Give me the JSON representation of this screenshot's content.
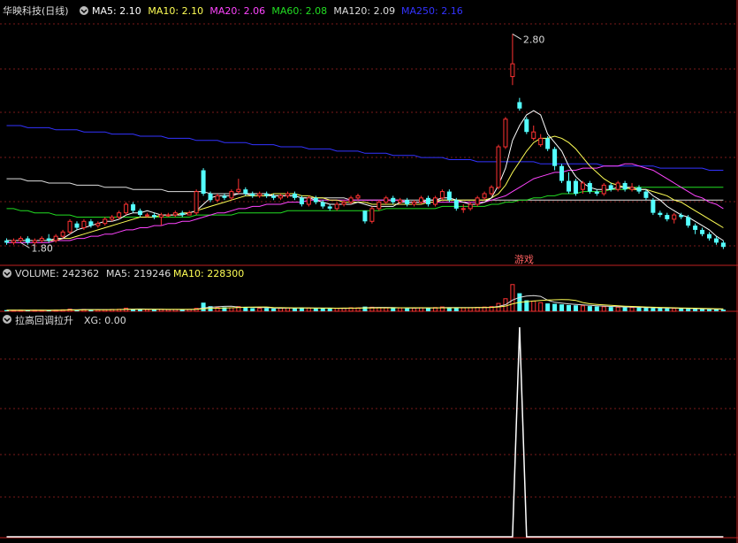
{
  "header": {
    "stock_name": "华映科技(日线)",
    "ma": [
      {
        "label": "MA5: 2.10",
        "color": "#ffffff"
      },
      {
        "label": "MA10: 2.10",
        "color": "#ffff55"
      },
      {
        "label": "MA20: 2.06",
        "color": "#ff44ff"
      },
      {
        "label": "MA60: 2.08",
        "color": "#22dd22"
      },
      {
        "label": "MA120: 2.09",
        "color": "#dddddd"
      },
      {
        "label": "MA250: 2.16",
        "color": "#3333ff"
      }
    ]
  },
  "price_panel": {
    "high_label": "2.80",
    "low_label": "1.80",
    "marker_label": "游戏"
  },
  "volume_panel": {
    "title": "VOLUME: 242362",
    "ma5": "MA5: 219246",
    "ma10": "MA10: 228300",
    "colors": {
      "title": "#dddddd",
      "ma5": "#dddddd",
      "ma10": "#ffff55"
    }
  },
  "indicator_panel": {
    "title": "拉高回调拉升",
    "value": "XG: 0.00"
  },
  "colors": {
    "up": "#ff3232",
    "down": "#54ffff",
    "grid": "#7a1a1a",
    "separator": "#c02020"
  },
  "chart_data": {
    "type": "candlestick",
    "ylim": [
      1.78,
      2.86
    ],
    "note_high": 2.8,
    "note_low": 1.8,
    "candles": [
      [
        1.83,
        1.82,
        1.84,
        1.81
      ],
      [
        1.82,
        1.83,
        1.84,
        1.81
      ],
      [
        1.83,
        1.84,
        1.85,
        1.82
      ],
      [
        1.84,
        1.82,
        1.85,
        1.81
      ],
      [
        1.82,
        1.83,
        1.84,
        1.81
      ],
      [
        1.83,
        1.84,
        1.85,
        1.82
      ],
      [
        1.84,
        1.83,
        1.86,
        1.82
      ],
      [
        1.83,
        1.85,
        1.86,
        1.82
      ],
      [
        1.85,
        1.87,
        1.88,
        1.84
      ],
      [
        1.87,
        1.92,
        1.93,
        1.86
      ],
      [
        1.91,
        1.89,
        1.92,
        1.88
      ],
      [
        1.89,
        1.92,
        1.93,
        1.88
      ],
      [
        1.92,
        1.9,
        1.93,
        1.89
      ],
      [
        1.9,
        1.91,
        1.92,
        1.89
      ],
      [
        1.91,
        1.93,
        1.94,
        1.9
      ],
      [
        1.93,
        1.94,
        1.95,
        1.92
      ],
      [
        1.94,
        1.96,
        1.97,
        1.93
      ],
      [
        1.96,
        2.0,
        2.01,
        1.95
      ],
      [
        2.0,
        1.97,
        2.01,
        1.96
      ],
      [
        1.97,
        1.95,
        1.98,
        1.94
      ],
      [
        1.95,
        1.95,
        1.96,
        1.94
      ],
      [
        1.95,
        1.94,
        1.96,
        1.93
      ],
      [
        1.94,
        1.95,
        1.96,
        1.9
      ],
      [
        1.95,
        1.95,
        1.96,
        1.94
      ],
      [
        1.95,
        1.96,
        1.97,
        1.94
      ],
      [
        1.96,
        1.95,
        1.97,
        1.94
      ],
      [
        1.95,
        1.96,
        1.97,
        1.95
      ],
      [
        1.96,
        2.06,
        2.07,
        1.95
      ],
      [
        2.16,
        2.05,
        2.17,
        2.04
      ],
      [
        2.05,
        2.02,
        2.06,
        2.01
      ],
      [
        2.02,
        2.04,
        2.05,
        2.01
      ],
      [
        2.04,
        2.03,
        2.05,
        2.02
      ],
      [
        2.03,
        2.06,
        2.07,
        2.02
      ],
      [
        2.06,
        2.07,
        2.12,
        2.05
      ],
      [
        2.07,
        2.05,
        2.08,
        2.04
      ],
      [
        2.05,
        2.04,
        2.06,
        2.03
      ],
      [
        2.04,
        2.05,
        2.06,
        2.03
      ],
      [
        2.05,
        2.04,
        2.06,
        2.03
      ],
      [
        2.04,
        2.03,
        2.05,
        2.02
      ],
      [
        2.03,
        2.04,
        2.05,
        2.02
      ],
      [
        2.04,
        2.05,
        2.06,
        2.03
      ],
      [
        2.05,
        2.03,
        2.06,
        2.02
      ],
      [
        2.03,
        2.0,
        2.04,
        1.99
      ],
      [
        2.0,
        2.03,
        2.04,
        1.99
      ],
      [
        2.03,
        2.01,
        2.04,
        2.0
      ],
      [
        2.01,
        1.99,
        2.02,
        1.98
      ],
      [
        1.99,
        1.98,
        2.0,
        1.97
      ],
      [
        1.98,
        2.0,
        2.01,
        1.97
      ],
      [
        2.0,
        2.01,
        2.02,
        1.99
      ],
      [
        2.01,
        2.03,
        2.04,
        2.0
      ],
      [
        2.03,
        2.04,
        2.05,
        2.02
      ],
      [
        1.97,
        1.92,
        1.97,
        1.91
      ],
      [
        1.92,
        1.98,
        1.99,
        1.91
      ],
      [
        1.98,
        2.01,
        2.02,
        1.97
      ],
      [
        2.01,
        2.03,
        2.04,
        2.0
      ],
      [
        2.03,
        2.01,
        2.04,
        2.0
      ],
      [
        2.01,
        2.02,
        2.03,
        2.0
      ],
      [
        2.02,
        2.0,
        2.03,
        1.99
      ],
      [
        2.0,
        2.01,
        2.02,
        1.99
      ],
      [
        2.01,
        2.03,
        2.04,
        2.0
      ],
      [
        2.03,
        2.0,
        2.04,
        1.99
      ],
      [
        2.0,
        2.03,
        2.04,
        1.99
      ],
      [
        2.03,
        2.06,
        2.07,
        2.02
      ],
      [
        2.06,
        2.02,
        2.07,
        2.01
      ],
      [
        2.02,
        1.98,
        2.03,
        1.97
      ],
      [
        1.98,
        1.98,
        2.0,
        1.96
      ],
      [
        1.98,
        2.0,
        2.01,
        1.97
      ],
      [
        2.0,
        2.03,
        2.04,
        1.99
      ],
      [
        2.03,
        2.05,
        2.06,
        2.02
      ],
      [
        2.05,
        2.08,
        2.09,
        2.04
      ],
      [
        2.08,
        2.27,
        2.28,
        2.07
      ],
      [
        2.27,
        2.4,
        2.41,
        2.26
      ],
      [
        2.6,
        2.66,
        2.8,
        2.56
      ],
      [
        2.48,
        2.45,
        2.5,
        2.44
      ],
      [
        2.4,
        2.34,
        2.41,
        2.33
      ],
      [
        2.31,
        2.34,
        2.37,
        2.3
      ],
      [
        2.28,
        2.31,
        2.33,
        2.27
      ],
      [
        2.31,
        2.26,
        2.32,
        2.25
      ],
      [
        2.26,
        2.18,
        2.27,
        2.16
      ],
      [
        2.18,
        2.11,
        2.19,
        2.1
      ],
      [
        2.11,
        2.06,
        2.15,
        2.05
      ],
      [
        2.11,
        2.05,
        2.12,
        2.04
      ],
      [
        2.07,
        2.1,
        2.11,
        2.05
      ],
      [
        2.1,
        2.06,
        2.11,
        2.05
      ],
      [
        2.06,
        2.05,
        2.07,
        2.04
      ],
      [
        2.05,
        2.09,
        2.1,
        2.04
      ],
      [
        2.09,
        2.07,
        2.1,
        2.06
      ],
      [
        2.07,
        2.1,
        2.11,
        2.06
      ],
      [
        2.1,
        2.07,
        2.11,
        2.06
      ],
      [
        2.07,
        2.08,
        2.1,
        2.06
      ],
      [
        2.08,
        2.06,
        2.09,
        2.05
      ],
      [
        2.06,
        2.03,
        2.07,
        2.02
      ],
      [
        2.02,
        1.96,
        2.03,
        1.95
      ],
      [
        1.96,
        1.95,
        1.97,
        1.94
      ],
      [
        1.95,
        1.93,
        1.96,
        1.92
      ],
      [
        1.93,
        1.95,
        1.96,
        1.91
      ],
      [
        1.95,
        1.94,
        1.96,
        1.93
      ],
      [
        1.94,
        1.9,
        1.95,
        1.89
      ],
      [
        1.9,
        1.88,
        1.91,
        1.86
      ],
      [
        1.88,
        1.86,
        1.89,
        1.85
      ],
      [
        1.86,
        1.84,
        1.87,
        1.83
      ],
      [
        1.84,
        1.82,
        1.85,
        1.81
      ],
      [
        1.82,
        1.8,
        1.83,
        1.79
      ]
    ],
    "ma5": [
      1.83,
      1.83,
      1.83,
      1.83,
      1.83,
      1.83,
      1.83,
      1.84,
      1.84,
      1.86,
      1.88,
      1.89,
      1.9,
      1.91,
      1.92,
      1.92,
      1.93,
      1.95,
      1.96,
      1.96,
      1.97,
      1.96,
      1.95,
      1.95,
      1.95,
      1.95,
      1.96,
      1.97,
      2.0,
      2.03,
      2.04,
      2.04,
      2.04,
      2.05,
      2.05,
      2.05,
      2.05,
      2.05,
      2.04,
      2.04,
      2.04,
      2.04,
      2.03,
      2.03,
      2.02,
      2.01,
      2.0,
      2.0,
      2.0,
      2.0,
      2.01,
      2.0,
      1.99,
      1.99,
      1.99,
      1.99,
      2.01,
      2.01,
      2.01,
      2.01,
      2.02,
      2.02,
      2.03,
      2.03,
      2.02,
      2.01,
      2.0,
      2.0,
      2.01,
      2.03,
      2.09,
      2.17,
      2.3,
      2.37,
      2.42,
      2.44,
      2.42,
      2.33,
      2.29,
      2.25,
      2.18,
      2.13,
      2.1,
      2.08,
      2.07,
      2.07,
      2.07,
      2.08,
      2.08,
      2.08,
      2.07,
      2.07,
      2.04,
      2.02,
      1.99,
      1.97,
      1.95,
      1.94,
      1.92,
      1.9,
      1.88,
      1.85,
      1.83
    ],
    "ma10": [
      1.83,
      1.83,
      1.83,
      1.83,
      1.83,
      1.83,
      1.83,
      1.83,
      1.84,
      1.84,
      1.85,
      1.86,
      1.87,
      1.88,
      1.89,
      1.9,
      1.91,
      1.92,
      1.93,
      1.94,
      1.94,
      1.94,
      1.95,
      1.95,
      1.95,
      1.96,
      1.96,
      1.97,
      1.98,
      1.99,
      2.0,
      2.01,
      2.02,
      2.03,
      2.04,
      2.04,
      2.04,
      2.04,
      2.05,
      2.05,
      2.05,
      2.05,
      2.04,
      2.04,
      2.03,
      2.03,
      2.02,
      2.02,
      2.01,
      2.01,
      2.01,
      2.01,
      2.0,
      2.0,
      2.0,
      2.0,
      2.0,
      2.0,
      2.0,
      2.0,
      2.01,
      2.01,
      2.02,
      2.02,
      2.02,
      2.02,
      2.02,
      2.02,
      2.02,
      2.03,
      2.05,
      2.09,
      2.15,
      2.2,
      2.25,
      2.29,
      2.31,
      2.31,
      2.32,
      2.31,
      2.29,
      2.26,
      2.22,
      2.18,
      2.15,
      2.12,
      2.1,
      2.09,
      2.08,
      2.07,
      2.07,
      2.07,
      2.06,
      2.05,
      2.04,
      2.02,
      2.01,
      1.99,
      1.97,
      1.95,
      1.93,
      1.91,
      1.89
    ],
    "ma20": [
      1.82,
      1.82,
      1.82,
      1.82,
      1.82,
      1.82,
      1.82,
      1.83,
      1.83,
      1.83,
      1.84,
      1.84,
      1.85,
      1.85,
      1.86,
      1.86,
      1.87,
      1.88,
      1.88,
      1.89,
      1.89,
      1.9,
      1.9,
      1.91,
      1.91,
      1.92,
      1.92,
      1.93,
      1.94,
      1.95,
      1.96,
      1.96,
      1.97,
      1.98,
      1.98,
      1.99,
      1.99,
      2.0,
      2.0,
      2.0,
      2.01,
      2.01,
      2.01,
      2.02,
      2.02,
      2.02,
      2.02,
      2.02,
      2.02,
      2.02,
      2.02,
      2.02,
      2.02,
      2.02,
      2.02,
      2.02,
      2.02,
      2.01,
      2.01,
      2.01,
      2.01,
      2.01,
      2.01,
      2.01,
      2.01,
      2.01,
      2.01,
      2.01,
      2.01,
      2.02,
      2.03,
      2.04,
      2.06,
      2.08,
      2.1,
      2.12,
      2.13,
      2.14,
      2.15,
      2.15,
      2.16,
      2.16,
      2.17,
      2.17,
      2.17,
      2.18,
      2.18,
      2.18,
      2.19,
      2.19,
      2.18,
      2.17,
      2.16,
      2.14,
      2.12,
      2.1,
      2.08,
      2.06,
      2.04,
      2.03,
      2.01,
      2.0,
      1.98
    ],
    "ma60": [
      1.98,
      1.98,
      1.97,
      1.97,
      1.96,
      1.96,
      1.96,
      1.95,
      1.95,
      1.95,
      1.94,
      1.94,
      1.94,
      1.94,
      1.94,
      1.94,
      1.94,
      1.94,
      1.94,
      1.94,
      1.94,
      1.94,
      1.94,
      1.94,
      1.94,
      1.94,
      1.94,
      1.95,
      1.95,
      1.95,
      1.95,
      1.95,
      1.95,
      1.96,
      1.96,
      1.96,
      1.96,
      1.96,
      1.96,
      1.96,
      1.97,
      1.97,
      1.97,
      1.97,
      1.97,
      1.97,
      1.97,
      1.97,
      1.97,
      1.97,
      1.97,
      1.97,
      1.97,
      1.97,
      1.98,
      1.98,
      1.98,
      1.98,
      1.98,
      1.98,
      1.98,
      1.98,
      1.99,
      1.99,
      1.99,
      1.99,
      1.99,
      1.99,
      1.99,
      2.0,
      2.0,
      2.01,
      2.01,
      2.02,
      2.02,
      2.03,
      2.03,
      2.04,
      2.04,
      2.05,
      2.05,
      2.05,
      2.06,
      2.06,
      2.06,
      2.06,
      2.07,
      2.07,
      2.07,
      2.08,
      2.08,
      2.08,
      2.08,
      2.08,
      2.08,
      2.08,
      2.08,
      2.08,
      2.08,
      2.08,
      2.08,
      2.08,
      2.08
    ],
    "ma120": [
      2.12,
      2.12,
      2.12,
      2.11,
      2.11,
      2.11,
      2.1,
      2.1,
      2.1,
      2.1,
      2.09,
      2.09,
      2.09,
      2.09,
      2.08,
      2.08,
      2.08,
      2.08,
      2.07,
      2.07,
      2.07,
      2.07,
      2.07,
      2.06,
      2.06,
      2.06,
      2.06,
      2.06,
      2.06,
      2.05,
      2.05,
      2.05,
      2.05,
      2.05,
      2.05,
      2.04,
      2.04,
      2.04,
      2.04,
      2.04,
      2.04,
      2.04,
      2.03,
      2.03,
      2.03,
      2.03,
      2.03,
      2.03,
      2.03,
      2.02,
      2.02,
      2.02,
      2.02,
      2.02,
      2.02,
      2.02,
      2.02,
      2.02,
      2.02,
      2.02,
      2.02,
      2.02,
      2.02,
      2.02,
      2.02,
      2.02,
      2.02,
      2.02,
      2.02,
      2.02,
      2.02,
      2.02,
      2.02,
      2.02,
      2.02,
      2.02,
      2.02,
      2.02,
      2.02,
      2.02,
      2.02,
      2.02,
      2.02,
      2.02,
      2.02,
      2.02,
      2.02,
      2.02,
      2.02,
      2.02,
      2.02,
      2.02,
      2.02,
      2.02,
      2.02,
      2.02,
      2.02,
      2.02,
      2.02,
      2.02,
      2.02,
      2.02,
      2.02
    ],
    "ma250": [
      2.37,
      2.37,
      2.37,
      2.36,
      2.36,
      2.36,
      2.36,
      2.35,
      2.35,
      2.35,
      2.35,
      2.34,
      2.34,
      2.34,
      2.34,
      2.33,
      2.33,
      2.33,
      2.33,
      2.32,
      2.32,
      2.32,
      2.32,
      2.31,
      2.31,
      2.31,
      2.31,
      2.3,
      2.3,
      2.3,
      2.3,
      2.29,
      2.29,
      2.29,
      2.29,
      2.28,
      2.28,
      2.28,
      2.28,
      2.27,
      2.27,
      2.27,
      2.27,
      2.26,
      2.26,
      2.26,
      2.26,
      2.25,
      2.25,
      2.25,
      2.25,
      2.24,
      2.24,
      2.24,
      2.24,
      2.23,
      2.23,
      2.23,
      2.23,
      2.22,
      2.22,
      2.22,
      2.22,
      2.21,
      2.21,
      2.21,
      2.21,
      2.2,
      2.2,
      2.2,
      2.2,
      2.2,
      2.2,
      2.2,
      2.2,
      2.2,
      2.19,
      2.19,
      2.19,
      2.19,
      2.19,
      2.19,
      2.19,
      2.19,
      2.19,
      2.18,
      2.18,
      2.18,
      2.18,
      2.18,
      2.18,
      2.18,
      2.18,
      2.17,
      2.17,
      2.17,
      2.17,
      2.17,
      2.17,
      2.17,
      2.16,
      2.16,
      2.16
    ],
    "volume": [
      15,
      14,
      16,
      13,
      15,
      14,
      16,
      17,
      19,
      28,
      22,
      24,
      20,
      18,
      22,
      24,
      26,
      40,
      30,
      25,
      22,
      20,
      26,
      21,
      23,
      20,
      24,
      38,
      110,
      65,
      48,
      52,
      45,
      60,
      55,
      40,
      38,
      42,
      36,
      40,
      44,
      38,
      48,
      42,
      36,
      40,
      34,
      38,
      40,
      45,
      44,
      60,
      52,
      46,
      44,
      40,
      42,
      38,
      40,
      46,
      42,
      48,
      55,
      46,
      50,
      44,
      46,
      50,
      54,
      60,
      100,
      160,
      340,
      230,
      140,
      130,
      110,
      100,
      95,
      88,
      80,
      76,
      70,
      66,
      62,
      58,
      55,
      52,
      50,
      48,
      46,
      44,
      42,
      40,
      38,
      36,
      34,
      32,
      30,
      28,
      26,
      24,
      22
    ],
    "volume_ylim": [
      0,
      360
    ],
    "xg": {
      "index": 73,
      "value": 1,
      "ylim": [
        0,
        1
      ]
    }
  }
}
